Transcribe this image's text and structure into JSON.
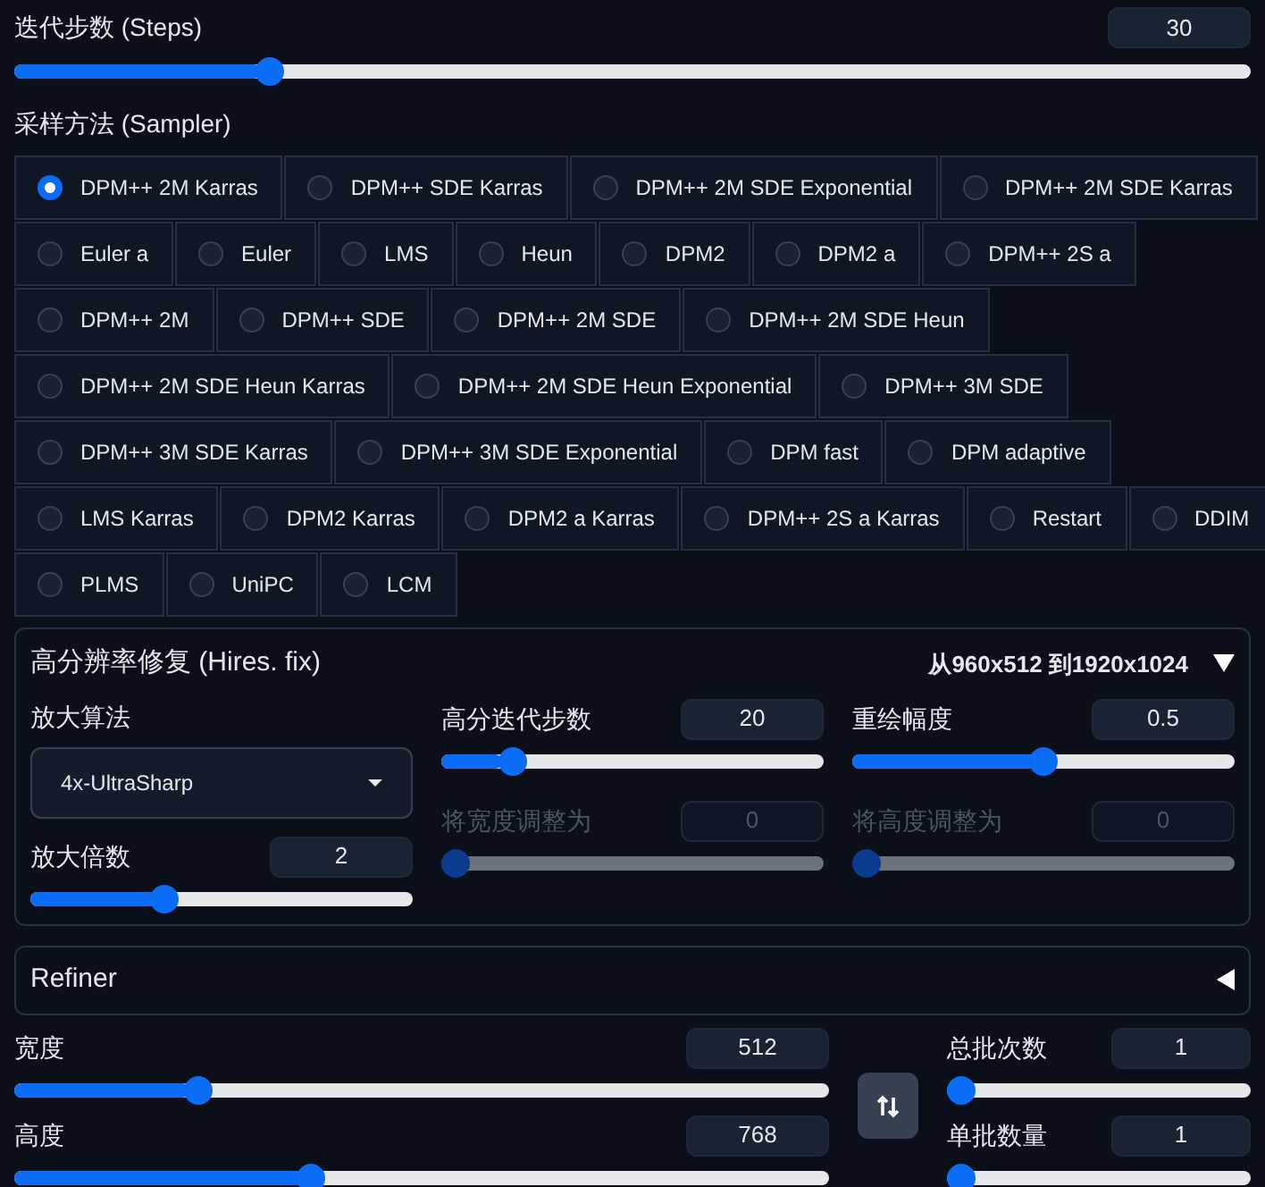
{
  "steps": {
    "label": "迭代步数 (Steps)",
    "value": "30",
    "level": 0.2
  },
  "sampler": {
    "label": "采样方法 (Sampler)",
    "lines": [
      {
        "options": [
          {
            "label": "DPM++ 2M Karras",
            "selected": true
          },
          {
            "label": "DPM++ SDE Karras",
            "selected": false
          },
          {
            "label": "DPM++ 2M SDE Exponential",
            "selected": false
          },
          {
            "label": "DPM++ 2M SDE Karras",
            "selected": false
          }
        ]
      },
      {
        "options": [
          {
            "label": "Euler a",
            "selected": false
          },
          {
            "label": "Euler",
            "selected": false
          },
          {
            "label": "LMS",
            "selected": false
          },
          {
            "label": "Heun",
            "selected": false
          },
          {
            "label": "DPM2",
            "selected": false
          },
          {
            "label": "DPM2 a",
            "selected": false
          },
          {
            "label": "DPM++ 2S a",
            "selected": false
          }
        ]
      },
      {
        "options": [
          {
            "label": "DPM++ 2M",
            "selected": false
          },
          {
            "label": "DPM++ SDE",
            "selected": false
          },
          {
            "label": "DPM++ 2M SDE",
            "selected": false
          },
          {
            "label": "DPM++ 2M SDE Heun",
            "selected": false
          }
        ]
      },
      {
        "options": [
          {
            "label": "DPM++ 2M SDE Heun Karras",
            "selected": false
          },
          {
            "label": "DPM++ 2M SDE Heun Exponential",
            "selected": false
          },
          {
            "label": "DPM++ 3M SDE",
            "selected": false
          }
        ]
      },
      {
        "options": [
          {
            "label": "DPM++ 3M SDE Karras",
            "selected": false
          },
          {
            "label": "DPM++ 3M SDE Exponential",
            "selected": false
          },
          {
            "label": "DPM fast",
            "selected": false
          },
          {
            "label": "DPM adaptive",
            "selected": false
          }
        ]
      },
      {
        "options": [
          {
            "label": "LMS Karras",
            "selected": false
          },
          {
            "label": "DPM2 Karras",
            "selected": false
          },
          {
            "label": "DPM2 a Karras",
            "selected": false
          },
          {
            "label": "DPM++ 2S a Karras",
            "selected": false
          },
          {
            "label": "Restart",
            "selected": false
          },
          {
            "label": "DDIM",
            "selected": false
          }
        ]
      },
      {
        "options": [
          {
            "label": "PLMS",
            "selected": false
          },
          {
            "label": "UniPC",
            "selected": false
          },
          {
            "label": "LCM",
            "selected": false
          }
        ]
      }
    ]
  },
  "hires": {
    "title": "高分辨率修复 (Hires. fix)",
    "summary": "从960x512 到1920x1024",
    "expanded": true,
    "upscaler": {
      "label": "放大算法",
      "value": "4x-UltraSharp"
    },
    "sliders": [
      {
        "label": "放大倍数",
        "value": "2",
        "level": 0.34,
        "disabled": false
      },
      {
        "label": "高分迭代步数",
        "value": "20",
        "level": 0.16,
        "disabled": false
      },
      {
        "label": "将宽度调整为",
        "value": "0",
        "level": 0,
        "disabled": true
      },
      {
        "label": "重绘幅度",
        "value": "0.5",
        "level": 0.5,
        "disabled": false
      },
      {
        "label": "将高度调整为",
        "value": "0",
        "level": 0,
        "disabled": true
      }
    ]
  },
  "refiner": {
    "title": "Refiner",
    "expanded": false
  },
  "size": [
    {
      "label": "宽度",
      "value": "512",
      "level": 0.215
    },
    {
      "label": "高度",
      "value": "768",
      "level": 0.36
    }
  ],
  "batch": [
    {
      "label": "总批次数",
      "value": "1",
      "level": 0
    },
    {
      "label": "单批数量",
      "value": "1",
      "level": 0
    }
  ]
}
